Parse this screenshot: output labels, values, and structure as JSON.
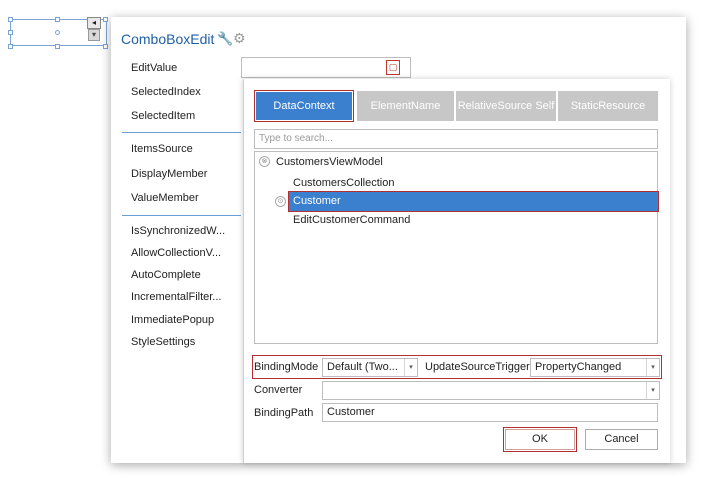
{
  "designer": {
    "smart_tag_glyph": "◂",
    "dropdown_glyph": "▾"
  },
  "panel": {
    "title": "ComboBoxEdit",
    "wrench_glyph": "🔧",
    "gear_glyph": "⚙",
    "properties_group1": [
      "EditValue",
      "SelectedIndex",
      "SelectedItem"
    ],
    "properties_group2": [
      "ItemsSource",
      "DisplayMember",
      "ValueMember"
    ],
    "properties_group3": [
      "IsSynchronizedW...",
      "AllowCollectionV...",
      "AutoComplete",
      "IncrementalFilter...",
      "ImmediatePopup",
      "StyleSettings"
    ]
  },
  "binding_editor": {
    "binding_button_glyph": "▢",
    "tabs": [
      "DataContext",
      "ElementName",
      "RelativeSource Self",
      "StaticResource"
    ],
    "active_tab": "DataContext",
    "search_placeholder": "Type to search...",
    "tree": {
      "root": "CustomersViewModel",
      "children": [
        "CustomersCollection",
        "Customer",
        "EditCustomerCommand"
      ],
      "selected": "Customer",
      "root_expander_glyph": "⊗",
      "child_expander_glyph": "⊙"
    },
    "binding_mode_label": "BindingMode",
    "binding_mode_value": "Default (Two...",
    "update_source_trigger_label": "UpdateSourceTrigger",
    "update_source_trigger_value": "PropertyChanged",
    "converter_label": "Converter",
    "converter_value": "",
    "binding_path_label": "BindingPath",
    "binding_path_value": "Customer",
    "ok_label": "OK",
    "cancel_label": "Cancel",
    "dropdown_glyph": "▾"
  },
  "colors": {
    "accent": "#3b7fcf",
    "highlight_border": "#b03030",
    "title": "#1f5fa6"
  }
}
